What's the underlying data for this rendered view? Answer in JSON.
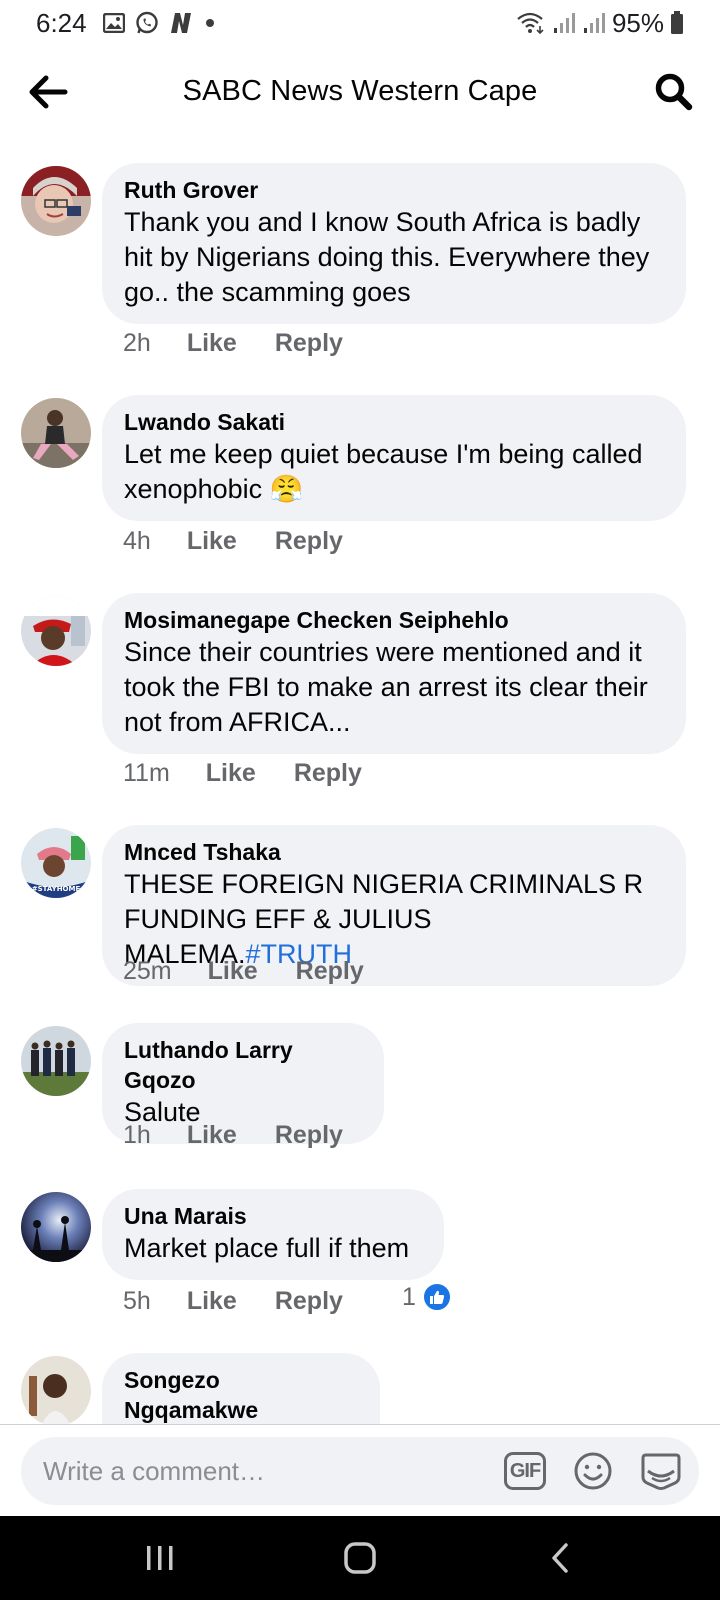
{
  "status_bar": {
    "time": "6:24",
    "battery": "95%",
    "icons": [
      "gallery-icon",
      "whatsapp-icon",
      "netflix-icon",
      "dot-icon",
      "wifi-icon",
      "signal-icon",
      "signal-icon",
      "battery-icon"
    ]
  },
  "header": {
    "title": "SABC News Western Cape",
    "back_icon": "arrow-left-icon",
    "search_icon": "search-icon"
  },
  "comments": [
    {
      "name": "Ruth Grover",
      "text": "Thank you and I know South Africa is badly hit by Nigerians doing this. Everywhere they go.. the scamming goes",
      "time": "2h",
      "like": "Like",
      "reply": "Reply"
    },
    {
      "name": "Lwando Sakati",
      "text": "Let me keep quiet because I'm being called xenophobic",
      "emoji": "😤",
      "time": "4h",
      "like": "Like",
      "reply": "Reply"
    },
    {
      "name": "Mosimanegape Checken Seiphehlo",
      "text": "Since their countries were mentioned and it took the FBI to make an arrest its clear their not from AFRICA...",
      "time": "11m",
      "like": "Like",
      "reply": "Reply"
    },
    {
      "name": "Mnced Tshaka",
      "text": "THESE FOREIGN NIGERIA CRIMINALS R FUNDING EFF & JULIUS MALEMA.",
      "hashtag": "#TRUTH",
      "avatar_badge": "#STAYHOME",
      "time": "25m",
      "like": "Like",
      "reply": "Reply"
    },
    {
      "name": "Luthando Larry Gqozo",
      "text": "Salute",
      "time": "1h",
      "like": "Like",
      "reply": "Reply"
    },
    {
      "name": "Una Marais",
      "text": "Market place full if them",
      "time": "5h",
      "like": "Like",
      "reply": "Reply",
      "reaction_count": "1"
    },
    {
      "name": "Songezo Ngqamakwe"
    }
  ],
  "composer": {
    "placeholder": "Write a comment…",
    "gif_label": "GIF",
    "emoji_icon": "smiley-icon",
    "sticker_icon": "sticker-icon"
  },
  "nav_bar": {
    "icons": [
      "recent-apps-icon",
      "home-icon",
      "back-icon"
    ]
  },
  "colors": {
    "bubble": "#f0f2f5",
    "secondary_text": "#65676b",
    "hashtag": "#216fdb",
    "like_blue": "#1b74e4",
    "nav_bar": "#000000"
  }
}
